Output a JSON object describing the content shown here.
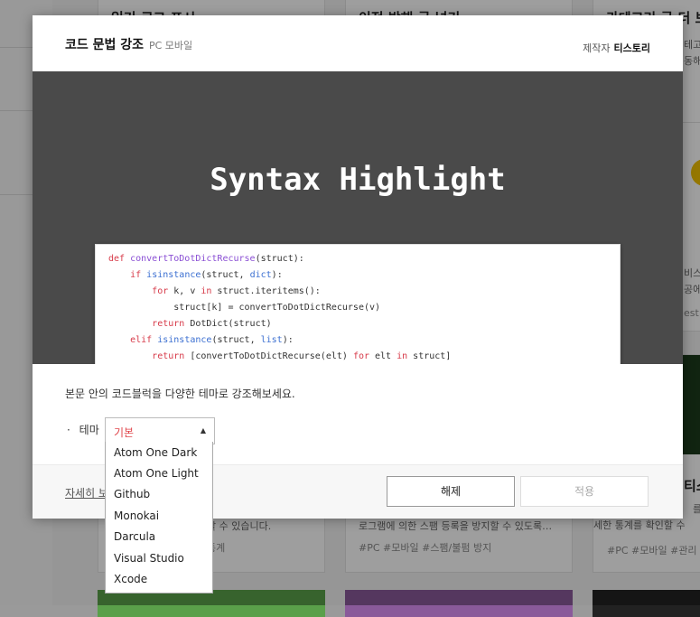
{
  "background": {
    "cards": [
      {
        "title": "읽기 로그 표시",
        "desc": [],
        "tags": ""
      },
      {
        "title": "이전 방해 글 넘기",
        "desc": [],
        "tags": ""
      },
      {
        "title": "카테고리 글 더 보기",
        "desc": [
          "테고",
          "동해"
        ],
        "tags": ""
      },
      {
        "title": "",
        "desc": [
          "비스",
          "공에"
        ],
        "tags": "est"
      },
      {
        "title": "",
        "desc": [],
        "tags": ""
      },
      {
        "title": "",
        "desc": [
          "할 수 있습니다."
        ],
        "tags": "통계"
      },
      {
        "title": "",
        "desc": [
          "로그램에 의한 스팸 등록을 방지할 수 있도록…"
        ],
        "tags": "#PC  #모바일  #스팸/불펌 방지"
      },
      {
        "title": "티스",
        "desc": [
          "를",
          "세한 통계를 확인할 수"
        ],
        "tags": "#PC  #모바일  #관리 및"
      }
    ]
  },
  "modal": {
    "title": "코드 문법 강조",
    "subtitle": "PC 모바일",
    "maker_label": "제작자",
    "maker_name": "티스토리",
    "banner_title": "Syntax Highlight",
    "code_lines": [
      "def convertToDotDictRecurse(struct):",
      "    if isinstance(struct, dict):",
      "        for k, v in struct.iteritems():",
      "            struct[k] = convertToDotDictRecurse(v)",
      "        return DotDict(struct)",
      "    elif isinstance(struct, list):",
      "        return [convertToDotDictRecurse(elt) for elt in struct]"
    ],
    "description": "본문 안의 코드블럭을 다양한 테마로 강조해보세요.",
    "theme_bullet": "·",
    "theme_label": "테마",
    "theme_selected": "기본",
    "theme_options": [
      "Atom One Dark",
      "Atom One Light",
      "Github",
      "Monokai",
      "Darcula",
      "Visual Studio",
      "Xcode"
    ],
    "more_link": "자세히 보기",
    "btn_disable": "해제",
    "btn_apply": "적용"
  },
  "colors": {
    "selected_theme": "#e0454b",
    "banner_bg": "#4a4a4a"
  }
}
